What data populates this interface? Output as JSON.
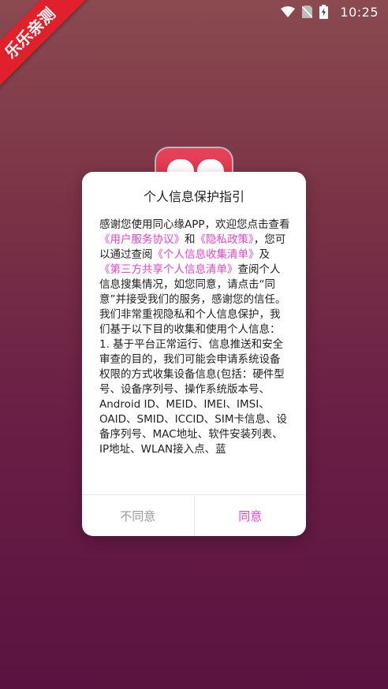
{
  "status_bar": {
    "time": "10:25",
    "icons": [
      "wifi-icon",
      "no-sim-icon",
      "battery-charging-icon"
    ]
  },
  "ribbon": {
    "label": "乐乐亲测"
  },
  "dialog": {
    "title": "个人信息保护指引",
    "body": {
      "p1_a": "感谢您使用同心缘APP，欢迎您点击查看",
      "link_user_agreement": "《用户服务协议》",
      "p1_b": "和",
      "link_privacy": "《隐私政策》",
      "p1_c": "，您可以通过查阅",
      "link_personal_info_list": "《个人信息收集清单》",
      "p1_d": "及",
      "link_third_party_list": "《第三方共享个人信息清单》",
      "p1_e": "查阅个人信息搜集情况，如您同意，请点击“同意”并接受我们的服务，感谢您的信任。",
      "p2": "我们非常重视隐私和个人信息保护，我们基于以下目的收集和使用个人信息：",
      "p3": "1. 基于平台正常运行、信息推送和安全审查的目的，我们可能会申请系统设备权限的方式收集设备信息(包括：硬件型号、设备序列号、操作系统版本号、Android ID、MEID、IMEI、IMSI、OAID、SMID、ICCID、SIM卡信息、设备序列号、MAC地址、软件安装列表、IP地址、WLAN接入点、蓝"
    },
    "buttons": {
      "disagree": "不同意",
      "agree": "同意"
    }
  },
  "colors": {
    "accent": "#e245c8",
    "ribbon": "#e0202a"
  }
}
